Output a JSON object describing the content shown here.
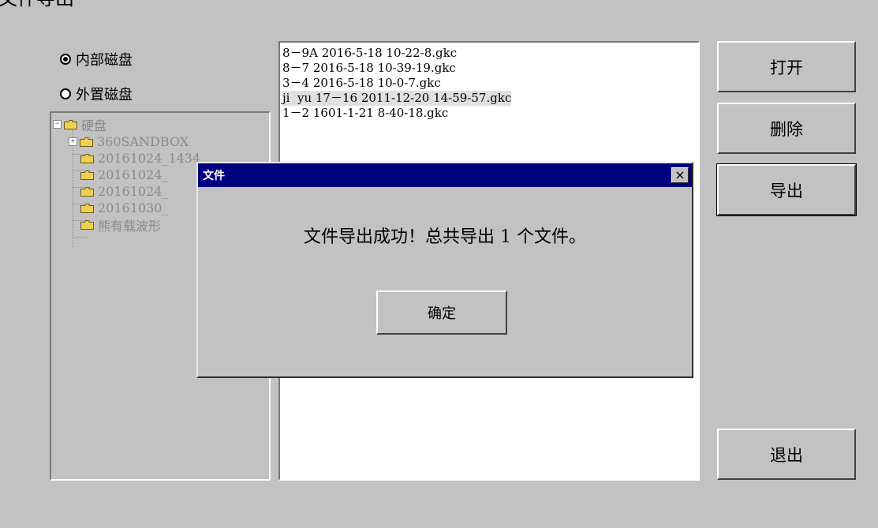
{
  "window": {
    "title": "文件导出"
  },
  "disk_options": [
    {
      "label": "内部磁盘",
      "checked": true
    },
    {
      "label": "外置磁盘",
      "checked": false
    }
  ],
  "tree": {
    "root": "硬盘",
    "items": [
      "360SANDBOX",
      "20161024_1434",
      "20161024_",
      "20161024_",
      "20161030_",
      "熊有载波形"
    ]
  },
  "files": [
    "8－9A 2016-5-18 10-22-8.gkc",
    "8－7 2016-5-18 10-39-19.gkc",
    "3－4 2016-5-18 10-0-7.gkc",
    "ji  yu 17－16 2011-12-20 14-59-57.gkc",
    "1－2 1601-1-21 8-40-18.gkc"
  ],
  "selected_file_index": 3,
  "buttons": {
    "open": "打开",
    "delete": "删除",
    "export": "导出",
    "exit": "退出"
  },
  "dialog": {
    "title": "文件",
    "close": "×",
    "message": "文件导出成功！总共导出 1 个文件。",
    "ok": "确定"
  }
}
